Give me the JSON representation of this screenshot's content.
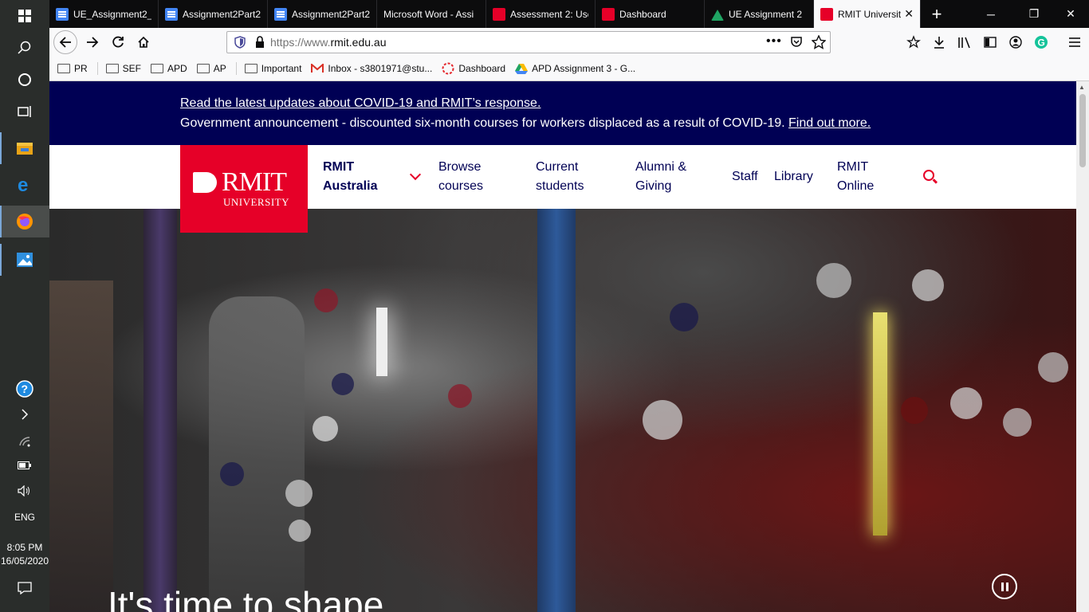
{
  "taskbar": {
    "time": "8:05 PM",
    "date": "16/05/2020",
    "language": "ENG"
  },
  "tabs": [
    {
      "label": "UE_Assignment2_",
      "icon": "google-docs-icon"
    },
    {
      "label": "Assignment2Part2",
      "icon": "google-docs-icon"
    },
    {
      "label": "Assignment2Part2",
      "icon": "google-docs-icon"
    },
    {
      "label": "Microsoft Word - Assi",
      "icon": "none"
    },
    {
      "label": "Assessment 2: Use",
      "icon": "canvas-icon"
    },
    {
      "label": "Dashboard",
      "icon": "canvas-icon"
    },
    {
      "label": "UE Assignment 2",
      "icon": "google-drive-icon"
    },
    {
      "label": "RMIT Universit",
      "icon": "rmit-icon",
      "selected": true
    }
  ],
  "urlbar": {
    "prefix": "https://www.",
    "domain": "rmit.edu.au"
  },
  "bookmarks": [
    {
      "label": "PR",
      "icon": "folder-icon"
    },
    {
      "label": "SEF",
      "icon": "folder-icon"
    },
    {
      "label": "APD",
      "icon": "folder-icon"
    },
    {
      "label": "AP",
      "icon": "folder-icon"
    },
    {
      "label": "Important",
      "icon": "folder-icon"
    },
    {
      "label": "Inbox - s3801971@stu...",
      "icon": "gmail-icon"
    },
    {
      "label": "Dashboard",
      "icon": "canvas-icon"
    },
    {
      "label": "APD Assignment 3 - G...",
      "icon": "google-drive-icon"
    }
  ],
  "covid_banner": {
    "line1": "Read the latest updates about COVID-19 and RMIT’s response.",
    "line2": "Government announcement - discounted six-month courses for workers displaced as a result of COVID-19.",
    "line2_link": "Find out more."
  },
  "logo": {
    "word": "RMIT",
    "sub": "UNIVERSITY"
  },
  "header_nav": {
    "region_line1": "RMIT",
    "region_line2": "Australia",
    "browse_line1": "Browse",
    "browse_line2": "courses",
    "current_line1": "Current",
    "current_line2": "students",
    "alumni_line1": "Alumni &",
    "alumni_line2": "Giving",
    "staff": "Staff",
    "library": "Library",
    "online_line1": "RMIT",
    "online_line2": "Online"
  },
  "hero": {
    "title": "It's time to shape"
  },
  "colors": {
    "rmit_red": "#e60028",
    "rmit_navy": "#000054"
  }
}
